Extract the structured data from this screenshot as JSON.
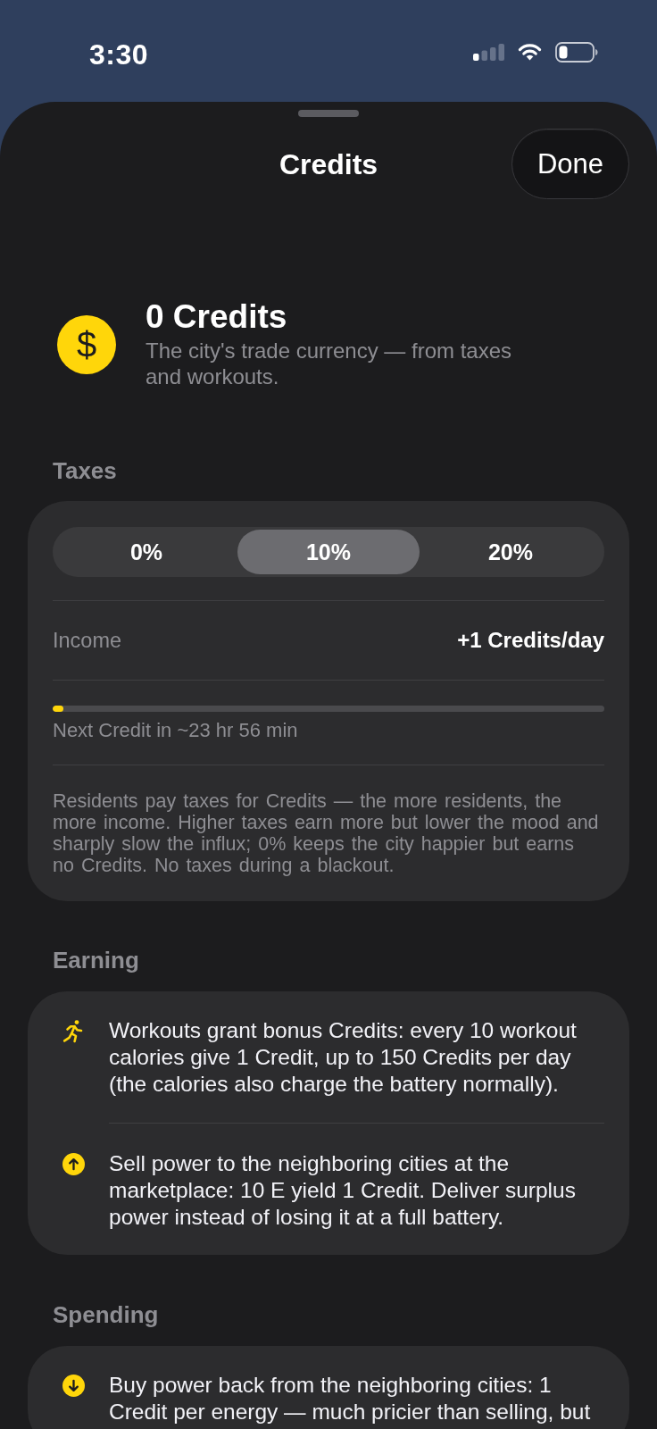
{
  "status_bar": {
    "time": "3:30"
  },
  "sheet": {
    "title": "Credits",
    "done_button": "Done"
  },
  "balance": {
    "symbol": "$",
    "amount": "0 Credits",
    "description": "The city's trade currency — from taxes and workouts."
  },
  "taxes": {
    "heading": "Taxes",
    "rates": [
      {
        "label": "0%",
        "selected": false
      },
      {
        "label": "10%",
        "selected": true
      },
      {
        "label": "20%",
        "selected": false
      }
    ],
    "income_label": "Income",
    "income_value": "+1 Credits/day",
    "progress": {
      "level": 0.02,
      "caption": "Next Credit in ~23 hr 56 min"
    },
    "note": "Residents pay taxes for Credits — the more residents, the more income. Higher taxes earn more but lower the mood and sharply slow the influx; 0% keeps the city happier but earns no Credits. No taxes during a blackout."
  },
  "earning": {
    "heading": "Earning",
    "items": [
      {
        "kind": "workout",
        "text": "Workouts grant bonus Credits: every 10 workout calories give 1 Credit, up to 150 Credits per day (the calories also charge the battery normally)."
      },
      {
        "kind": "sell",
        "text": "Sell power to the neighboring cities at the marketplace: 10 E yield 1 Credit. Deliver surplus power instead of losing it at a full battery."
      }
    ]
  },
  "spending": {
    "heading": "Spending",
    "items": [
      {
        "kind": "buy",
        "text": "Buy power back from the neighboring cities: 1 Credit per energy — much pricier than selling, but"
      }
    ]
  }
}
